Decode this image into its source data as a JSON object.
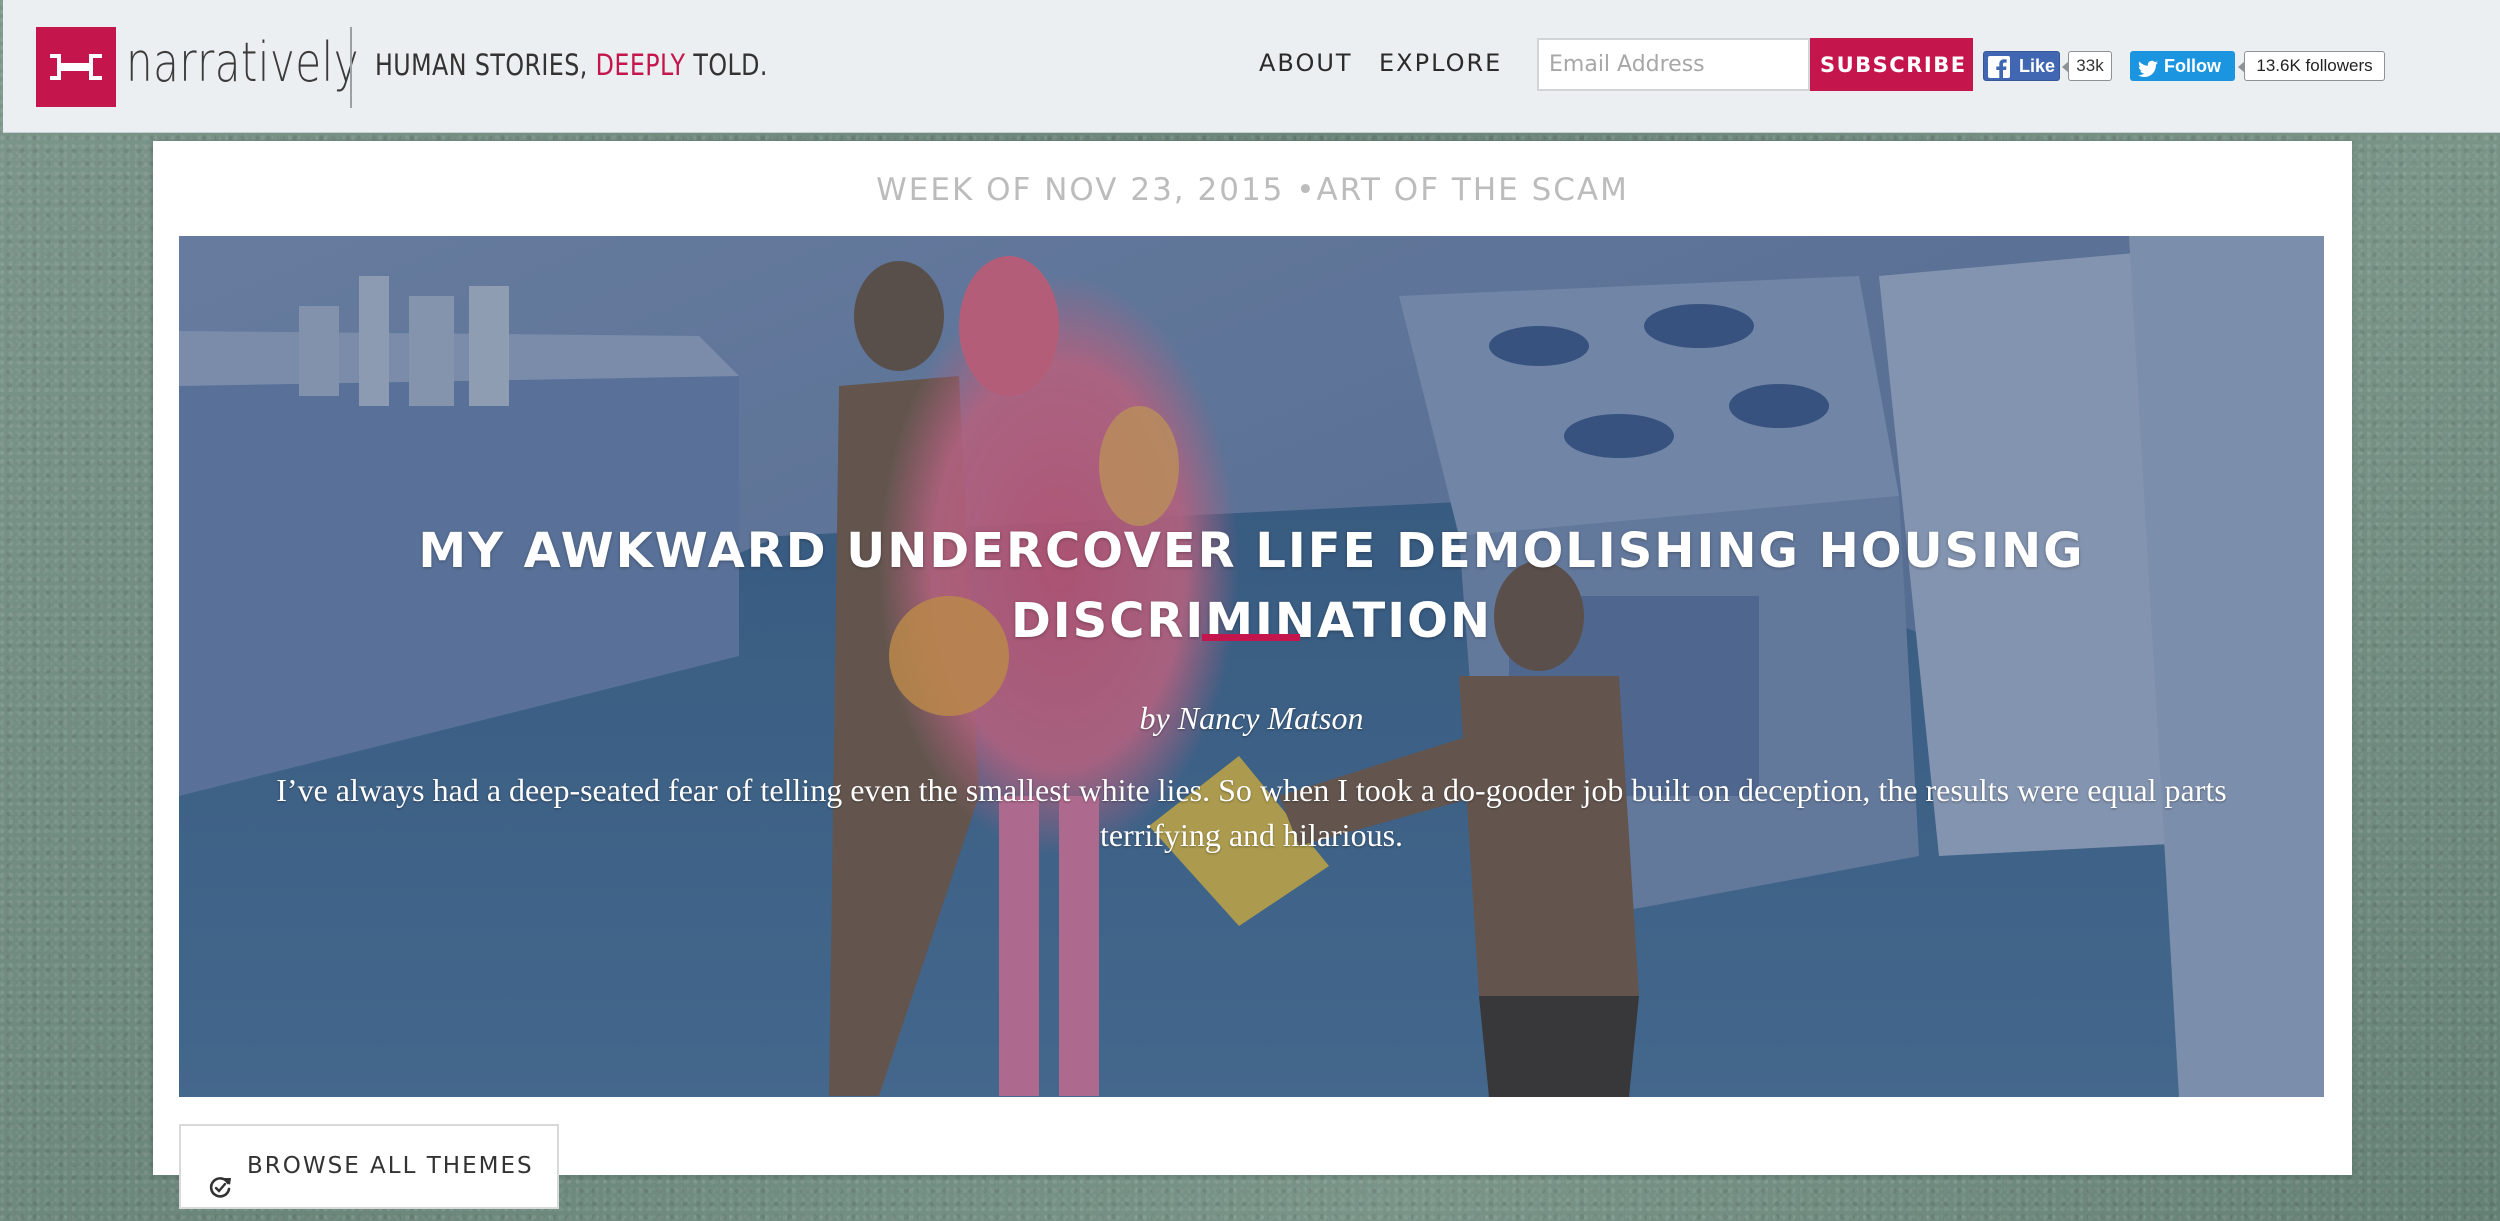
{
  "header": {
    "logo_text": "narratively",
    "tagline_prefix": "HUMAN STORIES, ",
    "tagline_accent": "DEEPLY",
    "tagline_suffix": " TOLD.",
    "nav": {
      "about": "ABOUT",
      "explore": "EXPLORE"
    },
    "newsletter": {
      "email_placeholder": "Email Address",
      "subscribe_label": "SUBSCRIBE T"
    },
    "social": {
      "facebook_like_label": "Like",
      "facebook_count": "33k",
      "twitter_follow_label": "Follow",
      "twitter_followers": "13.6K followers"
    }
  },
  "theme": {
    "week_line": "WEEK OF NOV 23, 2015 •ART OF THE SCAM"
  },
  "story": {
    "title": "MY AWKWARD UNDERCOVER LIFE DEMOLISHING HOUSING DISCRIMINATION",
    "byline": "by Nancy Matson",
    "dek": "I’ve always had a deep-seated fear of telling even the smallest white lies. So when I took a do-gooder job built on deception, the results were equal parts terrifying and hilarious."
  },
  "browse": {
    "label": "BROWSE ALL THEMES"
  },
  "colors": {
    "brand": "#c4154c",
    "facebook": "#4267b2",
    "twitter": "#1b95e0"
  },
  "icons": [
    "logo-icon",
    "facebook-icon",
    "twitter-bird-icon",
    "refresh-icon"
  ]
}
